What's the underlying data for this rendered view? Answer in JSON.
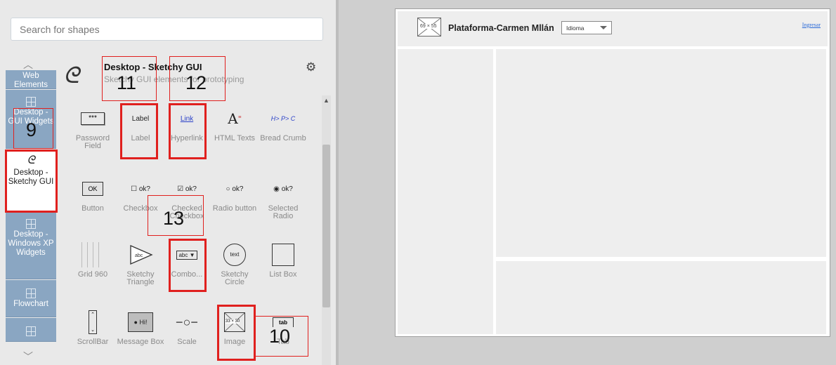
{
  "search": {
    "placeholder": "Search for shapes"
  },
  "categories": {
    "web_elements": "Web Elements",
    "gui_widgets": "Desktop - GUI Widgets",
    "sketchy": "Desktop - Sketchy GUI",
    "windows_xp": "Desktop - Windows XP Widgets",
    "flowchart": "Flowchart"
  },
  "library": {
    "title": "Desktop - Sketchy GUI",
    "subtitle": "Sketchy GUI elements for prototyping"
  },
  "shapes": {
    "password_field": "Password Field",
    "label": "Label",
    "hyperlink": "Hyperlink",
    "html_texts": "HTML Texts",
    "bread_crumb": "Bread Crumb",
    "button": "Button",
    "checkbox": "Checkbox",
    "checked_checkbox": "Checked Checkbox",
    "radio_button": "Radio button",
    "selected_radio": "Selected Radio",
    "grid_960": "Grid 960",
    "sketchy_triangle": "Sketchy Triangle",
    "combo": "Combo...",
    "sketchy_circle": "Sketchy Circle",
    "list_box": "List Box",
    "scrollbar": "ScrollBar",
    "message_box": "Message Box",
    "scale": "Scale",
    "image": "Image",
    "tab": "Tab"
  },
  "icon_text": {
    "password": "***",
    "label": "Label",
    "link": "Link",
    "breadcrumb": "H> P> C",
    "button": "OK",
    "ok": "ok?",
    "combo": "abc",
    "circle": "text",
    "message": "Hi!",
    "image": "33 × 30",
    "tab": "tab",
    "triangle": "abc"
  },
  "annotations": [
    "11",
    "12",
    "9",
    "13",
    "10"
  ],
  "canvas": {
    "site_title": "Plataforma-Carmen Mllán",
    "img_size": "69 × 55",
    "language_select": "Idioma",
    "login_link": "Ingresar"
  },
  "colors": {
    "category_bg": "#8aa6c2",
    "annotation": "#e0201e",
    "link": "#2a6ad8"
  }
}
